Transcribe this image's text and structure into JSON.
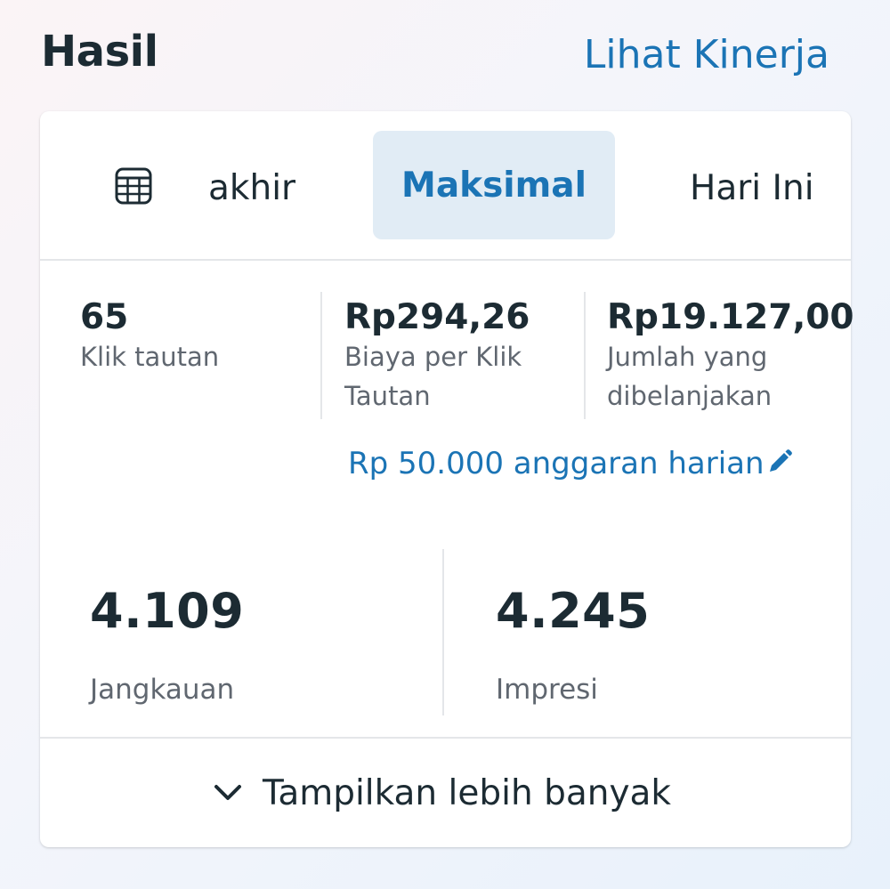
{
  "header": {
    "title": "Hasil",
    "see_performance": "Lihat Kinerja"
  },
  "tabs": {
    "calendar_icon": "calendar-grid-icon",
    "items": [
      {
        "label": "akhir",
        "selected": false
      },
      {
        "label": "Maksimal",
        "selected": true
      },
      {
        "label": "Hari Ini",
        "selected": false
      }
    ]
  },
  "metrics": [
    {
      "value": "65",
      "label": "Klik tautan"
    },
    {
      "value": "Rp294,26",
      "label": "Biaya per Klik Tautan"
    },
    {
      "value": "Rp19.127,00",
      "label": "Jumlah yang dibelanjakan"
    }
  ],
  "budget": {
    "text": "Rp 50.000 anggaran harian",
    "icon": "pencil-icon"
  },
  "big_metrics": [
    {
      "value": "4.109",
      "label": "Jangkauan"
    },
    {
      "value": "4.245",
      "label": "Impresi"
    }
  ],
  "show_more": {
    "label": "Tampilkan lebih banyak",
    "icon": "chevron-down-icon"
  },
  "colors": {
    "accent": "#1b74b5",
    "text": "#1c2b33",
    "muted": "#606770",
    "selected_tab_bg": "#e1ecf5"
  }
}
